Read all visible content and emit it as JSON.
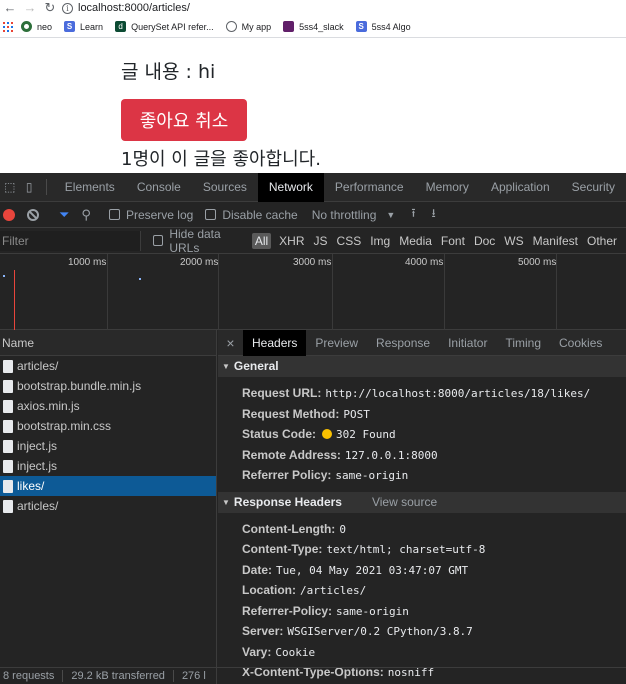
{
  "browser": {
    "url": "localhost:8000/articles/",
    "bookmarks": [
      {
        "label": "neo",
        "icon": "neo"
      },
      {
        "label": "Learn",
        "icon": "learn"
      },
      {
        "label": "QuerySet API refer...",
        "icon": "qs"
      },
      {
        "label": "My app",
        "icon": "myapp"
      },
      {
        "label": "5ss4_slack",
        "icon": "slack"
      },
      {
        "label": "5ss4 Algo",
        "icon": "algo"
      }
    ]
  },
  "page": {
    "content_line": "글 내용 : hi",
    "like_button": "좋아요 취소",
    "like_count_text": "1명이 이 글을 좋아합니다."
  },
  "devtools": {
    "tabs": [
      "Elements",
      "Console",
      "Sources",
      "Network",
      "Performance",
      "Memory",
      "Application",
      "Security"
    ],
    "active_tab": "Network",
    "toolbar": {
      "preserve_log": "Preserve log",
      "disable_cache": "Disable cache",
      "throttling": "No throttling"
    },
    "filter": {
      "placeholder": "Filter",
      "hide_data_urls": "Hide data URLs",
      "types": [
        "All",
        "XHR",
        "JS",
        "CSS",
        "Img",
        "Media",
        "Font",
        "Doc",
        "WS",
        "Manifest",
        "Other"
      ]
    },
    "timeline_ticks": [
      "1000 ms",
      "2000 ms",
      "3000 ms",
      "4000 ms",
      "5000 ms"
    ],
    "requests_header": "Name",
    "requests": [
      {
        "name": "articles/"
      },
      {
        "name": "bootstrap.bundle.min.js"
      },
      {
        "name": "axios.min.js"
      },
      {
        "name": "bootstrap.min.css"
      },
      {
        "name": "inject.js"
      },
      {
        "name": "inject.js"
      },
      {
        "name": "likes/"
      },
      {
        "name": "articles/"
      }
    ],
    "selected_request": "likes/",
    "status_bar": {
      "requests": "8 requests",
      "transferred": "29.2 kB transferred",
      "resources": "276 l"
    },
    "detail_tabs": [
      "Headers",
      "Preview",
      "Response",
      "Initiator",
      "Timing",
      "Cookies"
    ],
    "active_detail_tab": "Headers",
    "general": {
      "title": "General",
      "rows": [
        {
          "key": "Request URL:",
          "value": "http://localhost:8000/articles/18/likes/"
        },
        {
          "key": "Request Method:",
          "value": "POST"
        },
        {
          "key": "Status Code:",
          "value": "302 Found",
          "status_color": "#f9c000"
        },
        {
          "key": "Remote Address:",
          "value": "127.0.0.1:8000"
        },
        {
          "key": "Referrer Policy:",
          "value": "same-origin"
        }
      ]
    },
    "response_headers": {
      "title": "Response Headers",
      "view_source": "View source",
      "rows": [
        {
          "key": "Content-Length:",
          "value": "0"
        },
        {
          "key": "Content-Type:",
          "value": "text/html; charset=utf-8"
        },
        {
          "key": "Date:",
          "value": "Tue, 04 May 2021 03:47:07 GMT"
        },
        {
          "key": "Location:",
          "value": "/articles/"
        },
        {
          "key": "Referrer-Policy:",
          "value": "same-origin"
        },
        {
          "key": "Server:",
          "value": "WSGIServer/0.2 CPython/3.8.7"
        },
        {
          "key": "Vary:",
          "value": "Cookie"
        },
        {
          "key": "X-Content-Type-Options:",
          "value": "nosniff"
        }
      ]
    }
  }
}
